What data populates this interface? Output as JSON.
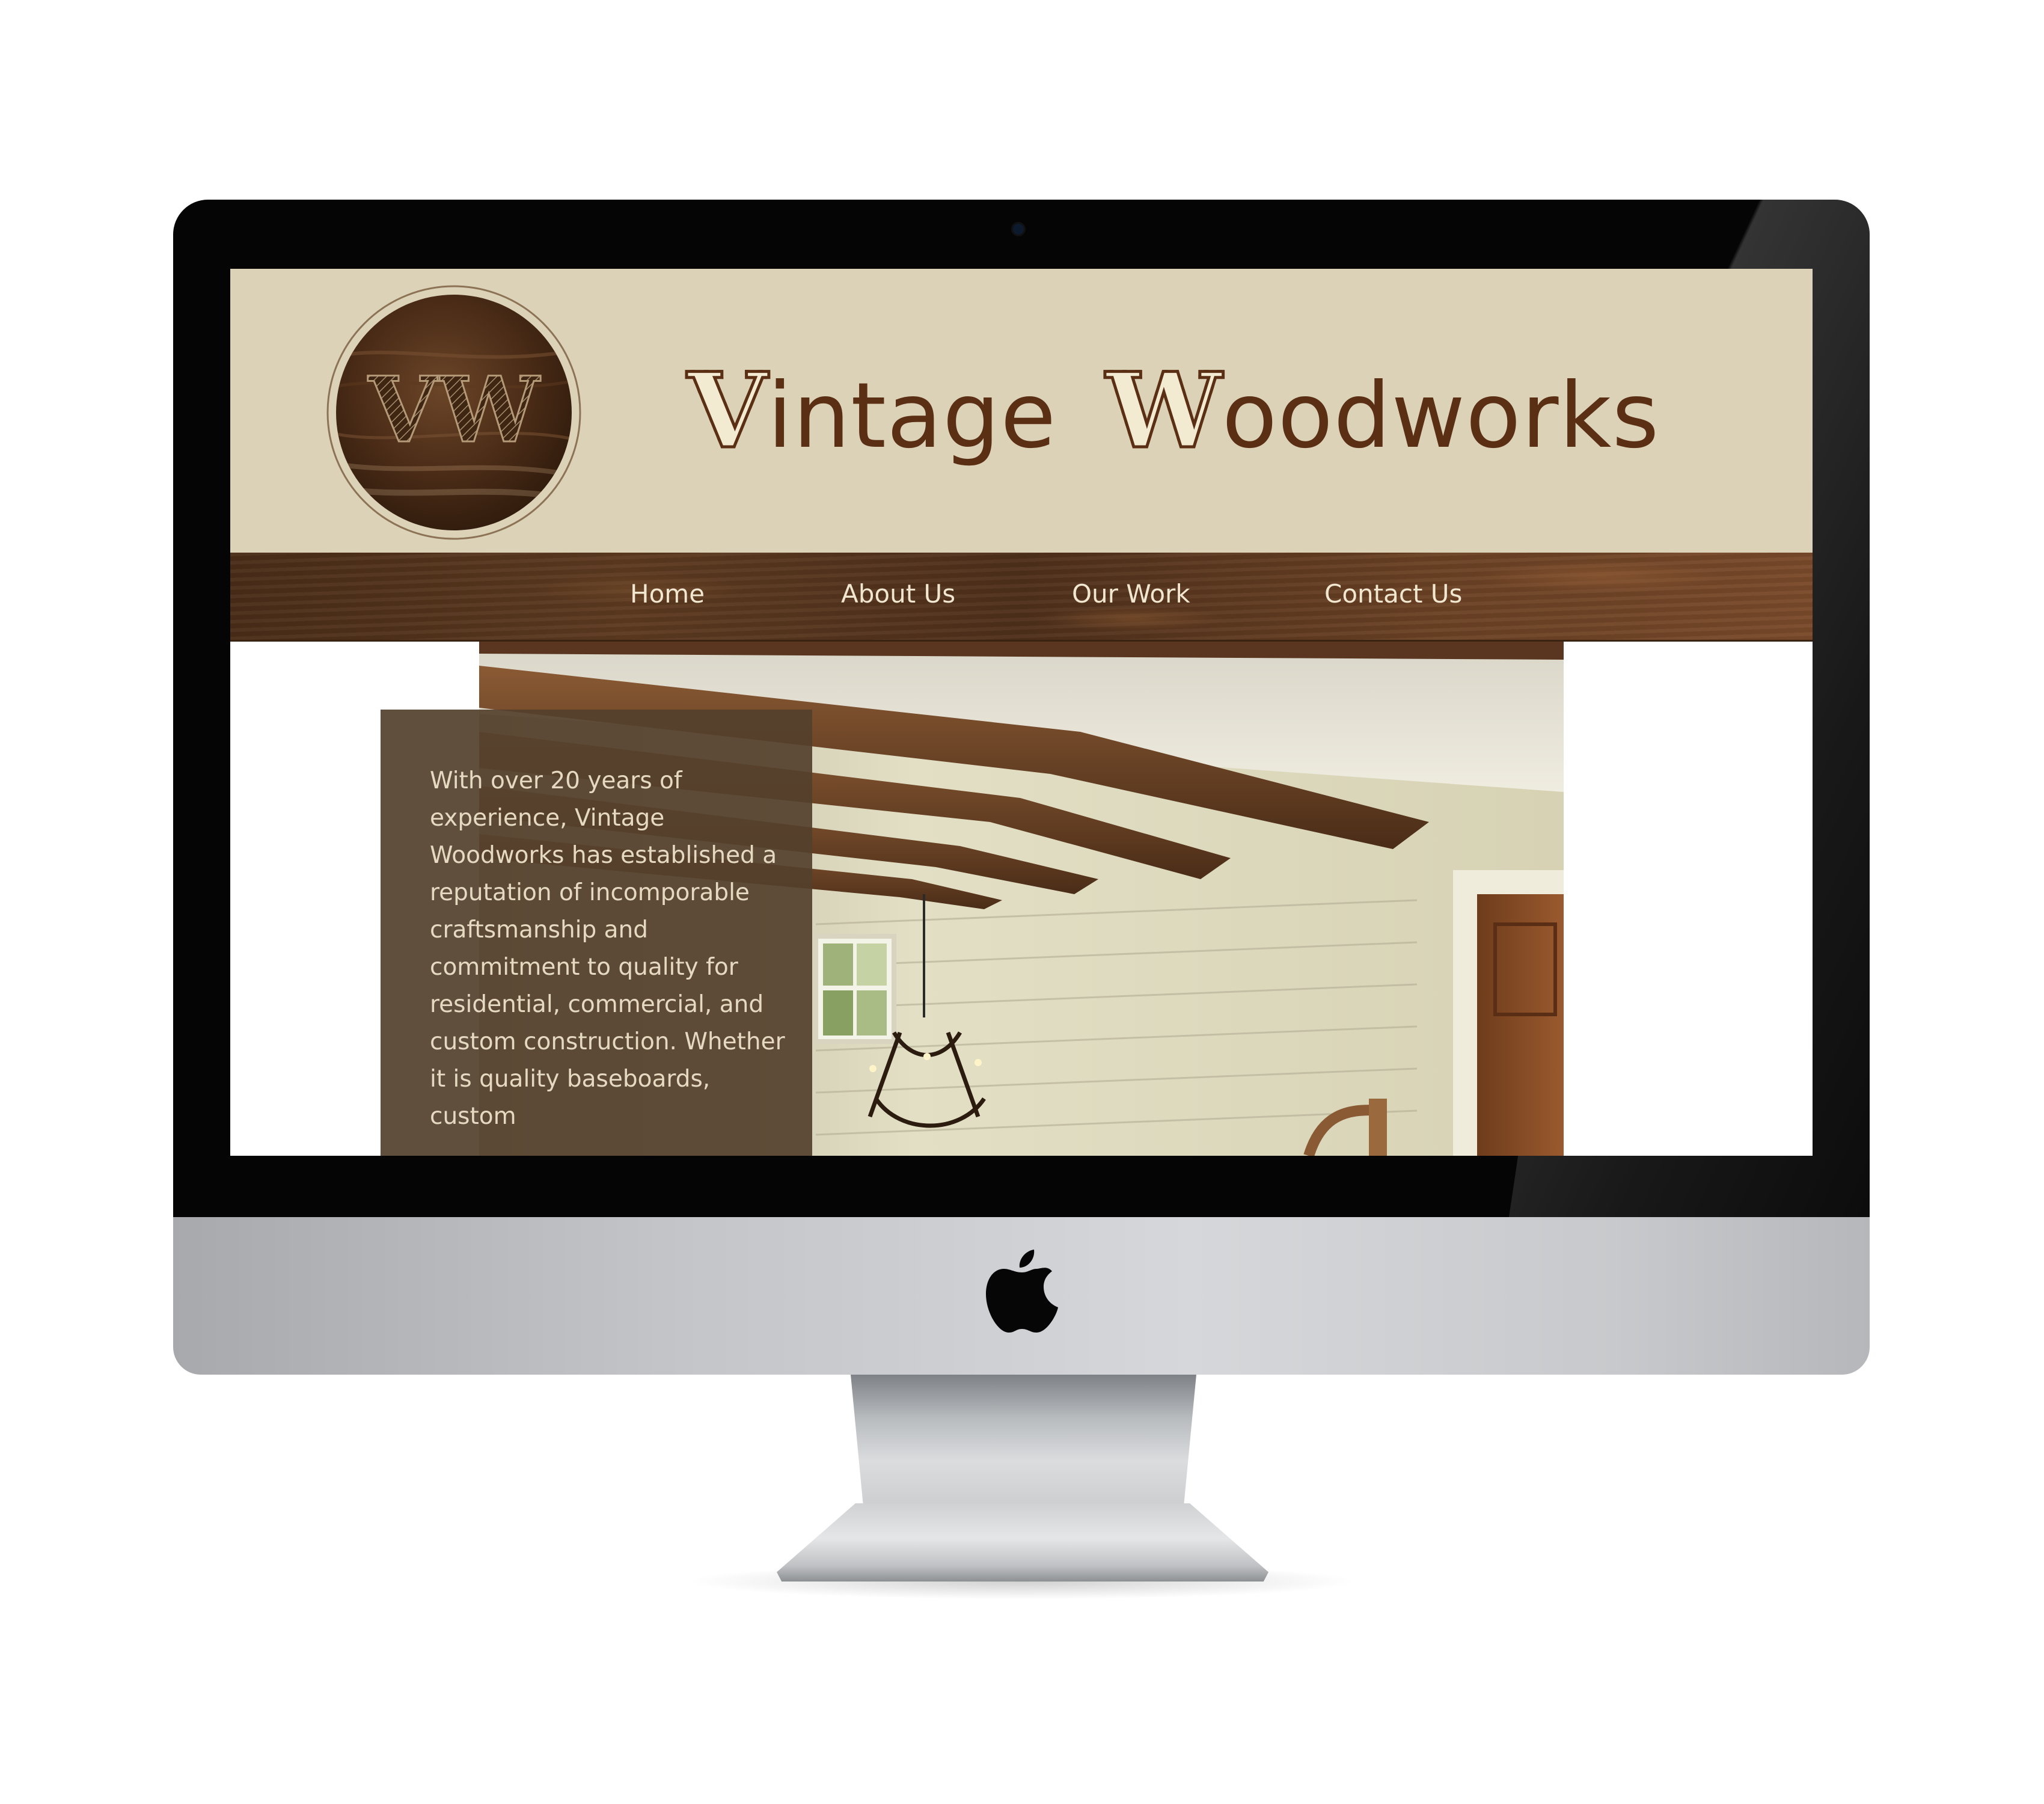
{
  "site": {
    "title_part1_initial": "V",
    "title_part1_rest": "intage",
    "title_part2_initial": "W",
    "title_part2_rest": "oodworks",
    "logo_monogram": "VW"
  },
  "nav": {
    "items": [
      {
        "label": "Home"
      },
      {
        "label": "About Us"
      },
      {
        "label": "Our Work"
      },
      {
        "label": "Contact Us"
      }
    ]
  },
  "intro": {
    "text": "With over 20 years of experience, Vintage Woodworks has established a reputation of incomporable craftsmanship and commitment to quality for residential, commercial, and custom construction. Whether it is quality baseboards, custom"
  },
  "colors": {
    "header_background": "#dcd2b8",
    "title_brown": "#5a2f14",
    "nav_wood": "#5d3a20",
    "nav_text": "#f1e6d0",
    "panel_background": "#54402c",
    "panel_text": "#e6d9c2",
    "bezel": "#050505",
    "chin_aluminum": "#c3c5c9"
  },
  "icons": {
    "brand_logo": "apple-logo-icon",
    "camera": "camera-icon"
  }
}
